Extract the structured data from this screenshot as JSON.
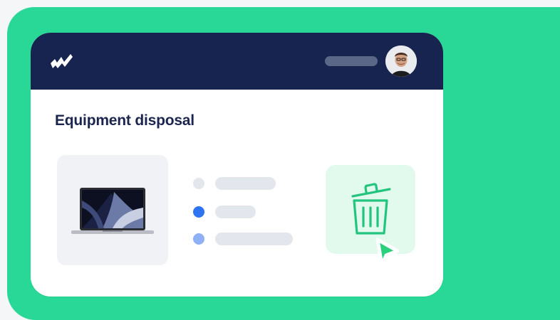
{
  "page": {
    "title": "Equipment disposal"
  },
  "header": {
    "logo_icon": "brand-logo-icon",
    "status_placeholder": "loading-pill",
    "avatar_icon": "user-avatar-icon"
  },
  "device": {
    "icon": "laptop-icon"
  },
  "list": {
    "items": [
      {
        "dot_color": "#e3e6ec",
        "state": "inactive",
        "bar_fraction": 0.42
      },
      {
        "dot_color": "#2e73f1",
        "state": "selected",
        "bar_fraction": 0.28
      },
      {
        "dot_color": "#8eb1f5",
        "state": "secondary",
        "bar_fraction": 0.54
      }
    ]
  },
  "action": {
    "icon": "trash-icon",
    "cursor_icon": "cursor-pointer-icon"
  },
  "colors": {
    "background_panel": "#29d796",
    "header": "#16244f",
    "title_text": "#1b2550",
    "trash_card": "#e2f9ee",
    "trash_stroke": "#22c47e",
    "accent_blue": "#2e73f1"
  }
}
